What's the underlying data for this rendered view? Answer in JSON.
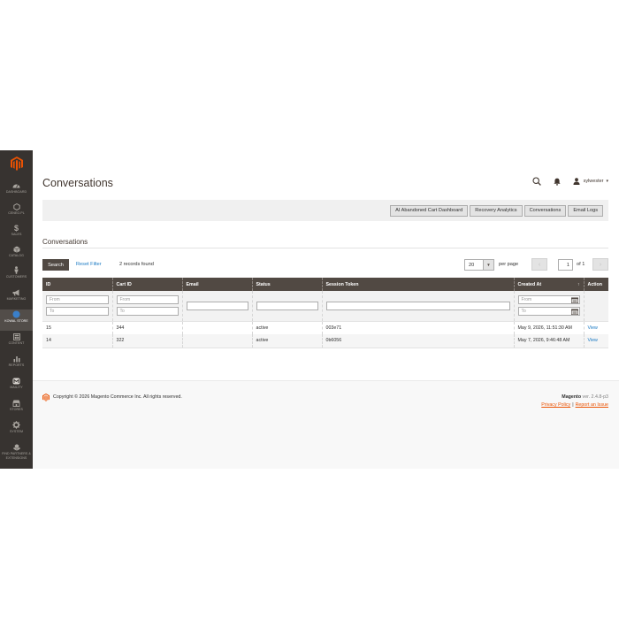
{
  "sidebar": {
    "items": [
      {
        "label": "DASHBOARD",
        "icon": "dashboard-icon"
      },
      {
        "label": "CENEO.PL",
        "icon": "hexagon-icon"
      },
      {
        "label": "SALES",
        "icon": "dollar-icon"
      },
      {
        "label": "CATALOG",
        "icon": "box-icon"
      },
      {
        "label": "CUSTOMERS",
        "icon": "person-icon"
      },
      {
        "label": "MARKETING",
        "icon": "megaphone-icon"
      },
      {
        "label": "KOWAL STORE",
        "icon": "globe-icon"
      },
      {
        "label": "CONTENT",
        "icon": "layout-icon"
      },
      {
        "label": "REPORTS",
        "icon": "bar-chart-icon"
      },
      {
        "label": "MAILITY",
        "icon": "m-logo-icon"
      },
      {
        "label": "STORES",
        "icon": "store-icon"
      },
      {
        "label": "SYSTEM",
        "icon": "gear-icon"
      },
      {
        "label": "FIND PARTNERS & EXTENSIONS",
        "icon": "cubes-icon"
      }
    ]
  },
  "header": {
    "title": "Conversations",
    "user": "sylwester"
  },
  "toolbar": {
    "buttons": [
      "AI Abandoned Cart Dashboard",
      "Recovery Analytics",
      "Conversations",
      "Email Logs"
    ]
  },
  "section": {
    "title": "Conversations"
  },
  "grid_controls": {
    "search_label": "Search",
    "reset_label": "Reset Filter",
    "records_found": "2 records found",
    "per_page_value": "20",
    "per_page_label": "per page",
    "current_page": "1",
    "of_pages": "of 1"
  },
  "table": {
    "columns": [
      "ID",
      "Cart ID",
      "Email",
      "Status",
      "Session Token",
      "Created At",
      "Action"
    ],
    "filter_from": "From",
    "filter_to": "To",
    "rows": [
      {
        "id": "15",
        "cart_id": "344",
        "email": "",
        "status": "active",
        "token": "003e71",
        "created_at": "May 9, 2026, 11:51:30 AM",
        "action": "View"
      },
      {
        "id": "14",
        "cart_id": "322",
        "email": "",
        "status": "active",
        "token": "0b6056",
        "created_at": "May 7, 2026, 9:46:48 AM",
        "action": "View"
      }
    ]
  },
  "footer": {
    "copyright": "Copyright © 2026 Magento Commerce Inc. All rights reserved.",
    "product": "Magento",
    "version": "ver. 2.4.8-p3",
    "privacy": "Privacy Policy",
    "separator": "|",
    "report": "Report an Issue"
  },
  "colors": {
    "sidebar_bg": "#373330",
    "table_header_bg": "#514943",
    "link": "#1979c3",
    "footer_link": "#eb5202",
    "logo": "#eb5202"
  }
}
